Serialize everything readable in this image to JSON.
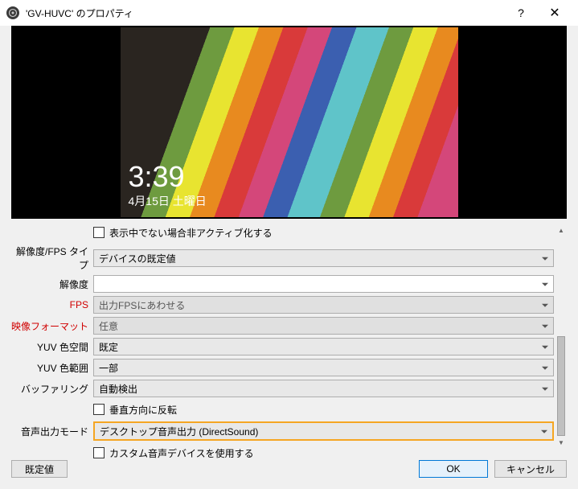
{
  "window": {
    "title": "'GV-HUVC' のプロパティ"
  },
  "preview": {
    "time": "3:39",
    "date": "4月15日 土曜日"
  },
  "form": {
    "deactive": {
      "label": "表示中でない場合非アクティブ化する"
    },
    "resolution_type": {
      "label": "解像度/FPS タイプ",
      "value": "デバイスの既定値"
    },
    "resolution": {
      "label": "解像度",
      "value": ""
    },
    "fps": {
      "label": "FPS",
      "value": "出力FPSにあわせる"
    },
    "video_format": {
      "label": "映像フォーマット",
      "value": "任意"
    },
    "yuv_space": {
      "label": "YUV 色空間",
      "value": "既定"
    },
    "yuv_range": {
      "label": "YUV 色範囲",
      "value": "一部"
    },
    "buffering": {
      "label": "バッファリング",
      "value": "自動検出"
    },
    "flip_vert": {
      "label": "垂直方向に反転"
    },
    "audio_mode": {
      "label": "音声出力モード",
      "value": "デスクトップ音声出力 (DirectSound)"
    },
    "custom_audio": {
      "label": "カスタム音声デバイスを使用する"
    }
  },
  "buttons": {
    "defaults": "既定値",
    "ok": "OK",
    "cancel": "キャンセル"
  }
}
